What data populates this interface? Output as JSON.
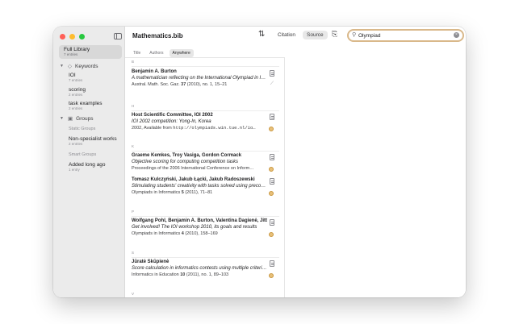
{
  "toolbar": {
    "document_title": "Mathematics.bib",
    "view_options": [
      "Citation",
      "Source"
    ],
    "active_view": "Source",
    "search": {
      "value": "Olympiad",
      "placeholder": "Search"
    },
    "icons": {
      "sort": "sort-arrows-icon",
      "clipboard": "clipboard-icon",
      "search": "magnifier-icon",
      "clear": "clear-x-icon"
    }
  },
  "sidebar": {
    "full_library": {
      "label": "Full Library",
      "count": "7 entries"
    },
    "keywords_header": "Keywords",
    "keywords": [
      {
        "label": "IOI",
        "count": "7 entries"
      },
      {
        "label": "scoring",
        "count": "2 entries"
      },
      {
        "label": "task examples",
        "count": "2 entries"
      }
    ],
    "groups_header": "Groups",
    "static_groups_label": "Static Groups",
    "static_groups": [
      {
        "label": "Non-specialist works",
        "count": "2 entries"
      }
    ],
    "smart_groups_label": "Smart Groups",
    "smart_groups": [
      {
        "label": "Added long ago",
        "count": "1 entry"
      }
    ]
  },
  "filters": [
    "Title",
    "Authors",
    "Anywhere"
  ],
  "active_filter": "Anywhere",
  "letters": [
    "B",
    "H",
    "K",
    "P",
    "S",
    "V"
  ],
  "entries": [
    {
      "author": "Benjamin A. Burton",
      "title": "A mathematician reflecting on the International Olympiad in I…",
      "source_journal": "Austral. Math. Soc. Gaz. ",
      "source_volume": "37",
      "source_rest": " (2010), no. 1, 15–21"
    },
    {
      "author": "Host Scientific Committee, IOI 2002",
      "title": "IOI 2002 competition: Yong-In, Korea",
      "source_prefix": "2002, Available from ",
      "source_url": "http://olympiads.win.tue.nl/io…"
    },
    {
      "author": "Graeme Kemkes, Troy Vasiga, Gordon Cormack",
      "title": "Objective scoring for computing competition tasks",
      "source": "Proceedings of the 2006 International Conference on Inform…"
    },
    {
      "author": "Tomasz Kulczyński, Jakub Łącki, Jakub Radoszewski",
      "title": "Stimulating students' creativity with tasks solved using preco…",
      "source_journal": "Olympiads in Informatics ",
      "source_volume": "5",
      "source_rest": " (2011), 71–81"
    },
    {
      "author": "Wolfgang Pohl, Benjamin A. Burton, Valentina Dagienė, Jitt…",
      "title": "Get involved! The IOI workshop 2010, its goals and results",
      "source_journal": "Olympiads in Informatics ",
      "source_volume": "4",
      "source_rest": " (2010), 158–169"
    },
    {
      "author": "Jūratė Skūpienė",
      "title": "Score calculation in informatics contests using multiple criteri…",
      "source_journal": "Informatics in Education ",
      "source_volume": "10",
      "source_rest": " (2011), no. 1, 89–103"
    }
  ],
  "colors": {
    "close": "#ff5f57",
    "minimize": "#febc2e",
    "zoom": "#28c840",
    "search_focus": "#d9b88a",
    "status": "#e8c07a"
  }
}
